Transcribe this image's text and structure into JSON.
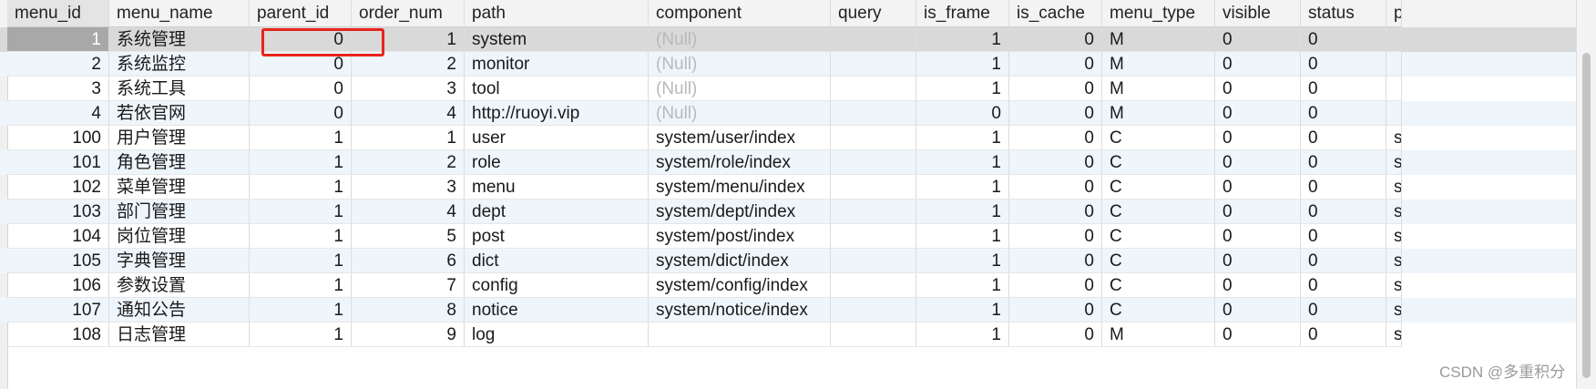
{
  "columns": [
    {
      "key": "menu_id",
      "label": "menu_id",
      "align": "right"
    },
    {
      "key": "menu_name",
      "label": "menu_name",
      "align": "left"
    },
    {
      "key": "parent_id",
      "label": "parent_id",
      "align": "right"
    },
    {
      "key": "order_num",
      "label": "order_num",
      "align": "right"
    },
    {
      "key": "path",
      "label": "path",
      "align": "left"
    },
    {
      "key": "component",
      "label": "component",
      "align": "left"
    },
    {
      "key": "query",
      "label": "query",
      "align": "left"
    },
    {
      "key": "is_frame",
      "label": "is_frame",
      "align": "right"
    },
    {
      "key": "is_cache",
      "label": "is_cache",
      "align": "right"
    },
    {
      "key": "menu_type",
      "label": "menu_type",
      "align": "left"
    },
    {
      "key": "visible",
      "label": "visible",
      "align": "left"
    },
    {
      "key": "status",
      "label": "status",
      "align": "left"
    },
    {
      "key": "perms",
      "label": "pe",
      "align": "left"
    }
  ],
  "rows": [
    {
      "menu_id": "1",
      "menu_name": "系统管理",
      "parent_id": "0",
      "order_num": "1",
      "path": "system",
      "component": "(Null)",
      "query": "",
      "is_frame": "1",
      "is_cache": "0",
      "menu_type": "M",
      "visible": "0",
      "status": "0",
      "perms": ""
    },
    {
      "menu_id": "2",
      "menu_name": "系统监控",
      "parent_id": "0",
      "order_num": "2",
      "path": "monitor",
      "component": "(Null)",
      "query": "",
      "is_frame": "1",
      "is_cache": "0",
      "menu_type": "M",
      "visible": "0",
      "status": "0",
      "perms": ""
    },
    {
      "menu_id": "3",
      "menu_name": "系统工具",
      "parent_id": "0",
      "order_num": "3",
      "path": "tool",
      "component": "(Null)",
      "query": "",
      "is_frame": "1",
      "is_cache": "0",
      "menu_type": "M",
      "visible": "0",
      "status": "0",
      "perms": ""
    },
    {
      "menu_id": "4",
      "menu_name": "若依官网",
      "parent_id": "0",
      "order_num": "4",
      "path": "http://ruoyi.vip",
      "component": "(Null)",
      "query": "",
      "is_frame": "0",
      "is_cache": "0",
      "menu_type": "M",
      "visible": "0",
      "status": "0",
      "perms": ""
    },
    {
      "menu_id": "100",
      "menu_name": "用户管理",
      "parent_id": "1",
      "order_num": "1",
      "path": "user",
      "component": "system/user/index",
      "query": "",
      "is_frame": "1",
      "is_cache": "0",
      "menu_type": "C",
      "visible": "0",
      "status": "0",
      "perms": "syst"
    },
    {
      "menu_id": "101",
      "menu_name": "角色管理",
      "parent_id": "1",
      "order_num": "2",
      "path": "role",
      "component": "system/role/index",
      "query": "",
      "is_frame": "1",
      "is_cache": "0",
      "menu_type": "C",
      "visible": "0",
      "status": "0",
      "perms": "syst"
    },
    {
      "menu_id": "102",
      "menu_name": "菜单管理",
      "parent_id": "1",
      "order_num": "3",
      "path": "menu",
      "component": "system/menu/index",
      "query": "",
      "is_frame": "1",
      "is_cache": "0",
      "menu_type": "C",
      "visible": "0",
      "status": "0",
      "perms": "syst"
    },
    {
      "menu_id": "103",
      "menu_name": "部门管理",
      "parent_id": "1",
      "order_num": "4",
      "path": "dept",
      "component": "system/dept/index",
      "query": "",
      "is_frame": "1",
      "is_cache": "0",
      "menu_type": "C",
      "visible": "0",
      "status": "0",
      "perms": "syst"
    },
    {
      "menu_id": "104",
      "menu_name": "岗位管理",
      "parent_id": "1",
      "order_num": "5",
      "path": "post",
      "component": "system/post/index",
      "query": "",
      "is_frame": "1",
      "is_cache": "0",
      "menu_type": "C",
      "visible": "0",
      "status": "0",
      "perms": "syst"
    },
    {
      "menu_id": "105",
      "menu_name": "字典管理",
      "parent_id": "1",
      "order_num": "6",
      "path": "dict",
      "component": "system/dict/index",
      "query": "",
      "is_frame": "1",
      "is_cache": "0",
      "menu_type": "C",
      "visible": "0",
      "status": "0",
      "perms": "syst"
    },
    {
      "menu_id": "106",
      "menu_name": "参数设置",
      "parent_id": "1",
      "order_num": "7",
      "path": "config",
      "component": "system/config/index",
      "query": "",
      "is_frame": "1",
      "is_cache": "0",
      "menu_type": "C",
      "visible": "0",
      "status": "0",
      "perms": "syst"
    },
    {
      "menu_id": "107",
      "menu_name": "通知公告",
      "parent_id": "1",
      "order_num": "8",
      "path": "notice",
      "component": "system/notice/index",
      "query": "",
      "is_frame": "1",
      "is_cache": "0",
      "menu_type": "C",
      "visible": "0",
      "status": "0",
      "perms": "syst"
    },
    {
      "menu_id": "108",
      "menu_name": "日志管理",
      "parent_id": "1",
      "order_num": "9",
      "path": "log",
      "component": "",
      "query": "",
      "is_frame": "1",
      "is_cache": "0",
      "menu_type": "M",
      "visible": "0",
      "status": "0",
      "perms": "syst"
    }
  ],
  "selected_row_index": 0,
  "highlighted_cell": {
    "row": 0,
    "column": "parent_id"
  },
  "watermark": "CSDN @多重积分",
  "colors": {
    "header_bg": "#f3f3f3",
    "selected_row": "#d9d9d9",
    "alt_row": "#eef5fb",
    "highlight_border": "#e8231d",
    "null_text": "#b9b9b9"
  }
}
